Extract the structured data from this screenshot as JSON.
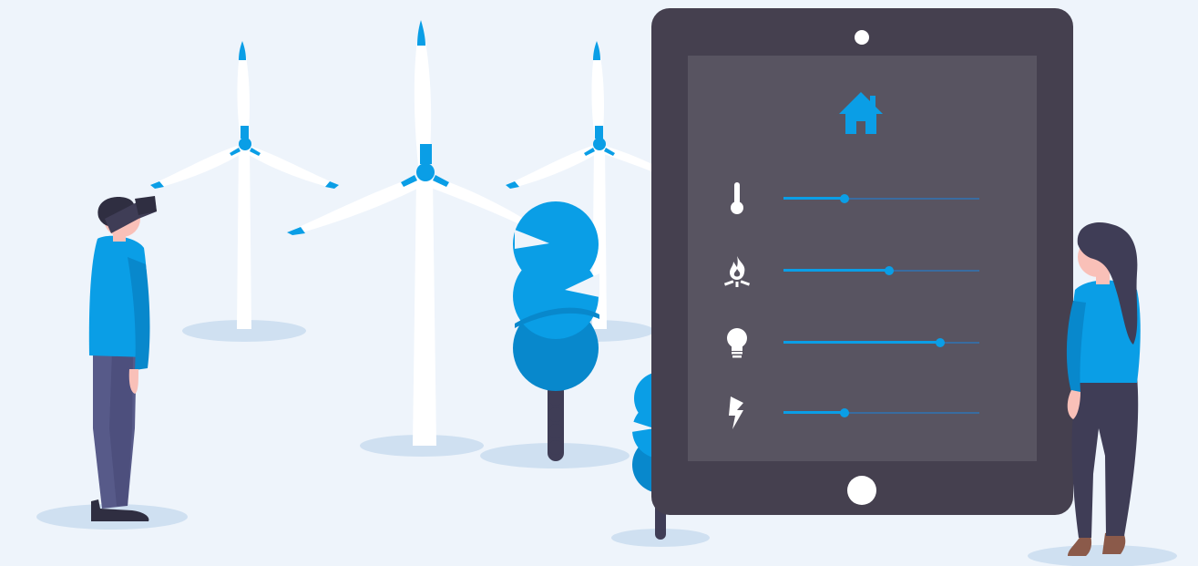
{
  "colors": {
    "background": "#eef4fb",
    "accent": "#0a9ee6",
    "accent_dark": "#0888cc",
    "tablet_frame": "#45404f",
    "tablet_screen": "#585461",
    "person_dark": "#3f3d56",
    "shadow": "#cfe0f1"
  },
  "tablet": {
    "header_icon": "home-icon",
    "controls": [
      {
        "icon": "thermometer-icon",
        "level": 0.31
      },
      {
        "icon": "flame-icon",
        "level": 0.54
      },
      {
        "icon": "lightbulb-icon",
        "level": 0.8
      },
      {
        "icon": "lightning-bolt-icon",
        "level": 0.31
      }
    ]
  }
}
